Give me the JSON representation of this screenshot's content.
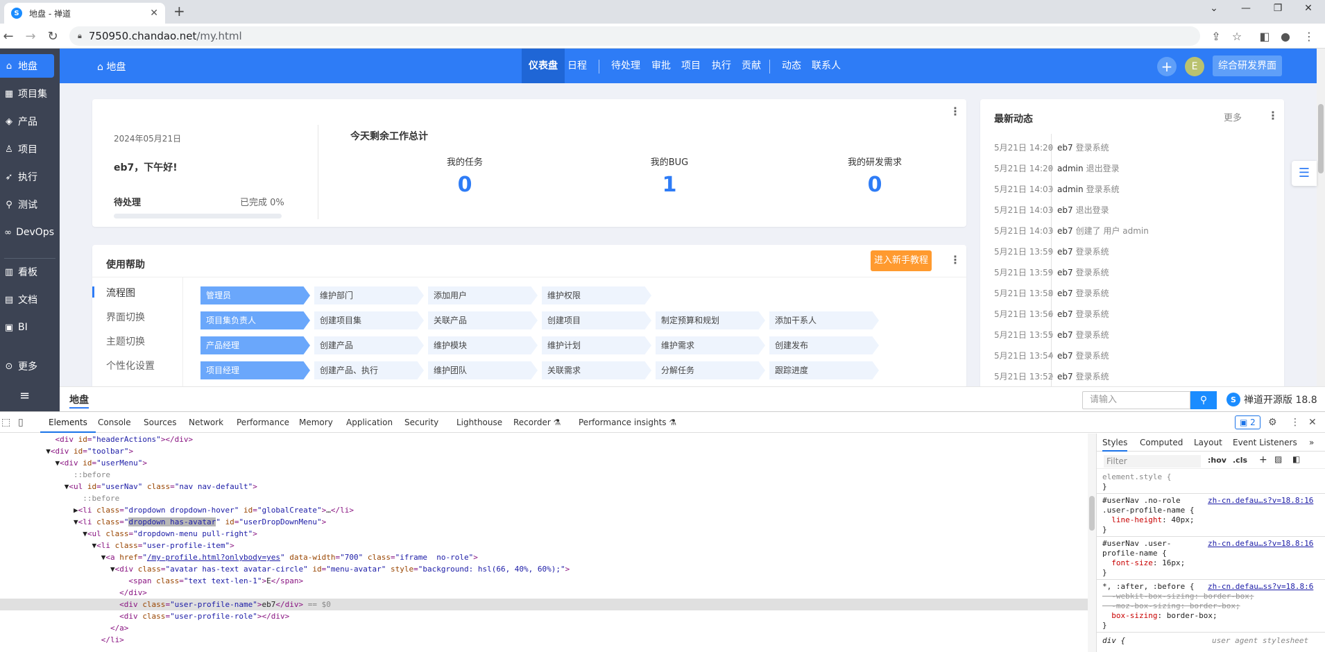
{
  "browser": {
    "tab_title": "地盘 - 禅道",
    "url_host": "750950.chandao.net",
    "url_path": "/my.html"
  },
  "sidebar": {
    "items": [
      {
        "label": "地盘",
        "icon": "house-icon",
        "glyph": "⌂"
      },
      {
        "label": "项目集",
        "icon": "grid-icon",
        "glyph": "▦"
      },
      {
        "label": "产品",
        "icon": "cube-icon",
        "glyph": "◈"
      },
      {
        "label": "项目",
        "icon": "bell-icon",
        "glyph": "♙"
      },
      {
        "label": "执行",
        "icon": "send-icon",
        "glyph": "➶"
      },
      {
        "label": "测试",
        "icon": "search-icon",
        "glyph": "⚲"
      },
      {
        "label": "DevOps",
        "icon": "infinity-icon",
        "glyph": "∞"
      },
      {
        "label": "看板",
        "icon": "board-icon",
        "glyph": "▥"
      },
      {
        "label": "文档",
        "icon": "doc-icon",
        "glyph": "▤"
      },
      {
        "label": "BI",
        "icon": "chart-icon",
        "glyph": "▣"
      },
      {
        "label": "更多",
        "icon": "more-icon",
        "glyph": "⊙"
      }
    ]
  },
  "topnav": {
    "home": "地盘",
    "items": [
      "仪表盘",
      "日程",
      "待处理",
      "审批",
      "项目",
      "执行",
      "贡献",
      "动态",
      "联系人"
    ],
    "avatar_letter": "E",
    "mode_button": "综合研发界面"
  },
  "welcome": {
    "date": "2024年05月21日",
    "greeting": "eb7，下午好!",
    "todo_label": "待处理",
    "done_label": "已完成 0%",
    "progress": 0
  },
  "summary": {
    "title": "今天剩余工作总计",
    "stats": [
      {
        "label": "我的任务",
        "value": "0"
      },
      {
        "label": "我的BUG",
        "value": "1"
      },
      {
        "label": "我的研发需求",
        "value": "0"
      }
    ]
  },
  "help": {
    "title": "使用帮助",
    "tutorial_button": "进入新手教程",
    "tabs": [
      "流程图",
      "界面切换",
      "主题切换",
      "个性化设置"
    ],
    "rows": [
      {
        "role": "管理员",
        "steps": [
          "维护部门",
          "添加用户",
          "维护权限"
        ]
      },
      {
        "role": "项目集负责人",
        "steps": [
          "创建项目集",
          "关联产品",
          "创建项目",
          "制定预算和规划",
          "添加干系人"
        ]
      },
      {
        "role": "产品经理",
        "steps": [
          "创建产品",
          "维护模块",
          "维护计划",
          "维护需求",
          "创建发布"
        ]
      },
      {
        "role": "项目经理",
        "steps": [
          "创建产品、执行",
          "维护团队",
          "关联需求",
          "分解任务",
          "跟踪进度"
        ]
      }
    ]
  },
  "activity": {
    "title": "最新动态",
    "more": "更多",
    "items": [
      {
        "time": "5月21日 14:20",
        "user": "eb7",
        "action": "登录系统"
      },
      {
        "time": "5月21日 14:20",
        "user": "admin",
        "action": "退出登录"
      },
      {
        "time": "5月21日 14:03",
        "user": "admin",
        "action": "登录系统"
      },
      {
        "time": "5月21日 14:03",
        "user": "eb7",
        "action": "退出登录"
      },
      {
        "time": "5月21日 14:03",
        "user": "eb7",
        "action": "创建了  用户  admin"
      },
      {
        "time": "5月21日 13:59",
        "user": "eb7",
        "action": "登录系统"
      },
      {
        "time": "5月21日 13:59",
        "user": "eb7",
        "action": "登录系统"
      },
      {
        "time": "5月21日 13:58",
        "user": "eb7",
        "action": "登录系统"
      },
      {
        "time": "5月21日 13:56",
        "user": "eb7",
        "action": "登录系统"
      },
      {
        "time": "5月21日 13:55",
        "user": "eb7",
        "action": "登录系统"
      },
      {
        "time": "5月21日 13:54",
        "user": "eb7",
        "action": "登录系统"
      },
      {
        "time": "5月21日 13:52",
        "user": "eb7",
        "action": "登录系统"
      }
    ]
  },
  "footer": {
    "crumb": "地盘",
    "search_placeholder": "请输入",
    "brand": "禅道开源版 18.8"
  },
  "devtools": {
    "tabs": [
      "Elements",
      "Console",
      "Sources",
      "Network",
      "Performance",
      "Memory",
      "Application",
      "Security",
      "Lighthouse",
      "Recorder ⚗",
      "Performance insights ⚗"
    ],
    "issues_count": "2",
    "styles_tabs": [
      "Styles",
      "Computed",
      "Layout",
      "Event Listeners"
    ],
    "filter_placeholder": "Filter",
    "filter_hov": ":hov",
    "filter_cls": ".cls"
  }
}
